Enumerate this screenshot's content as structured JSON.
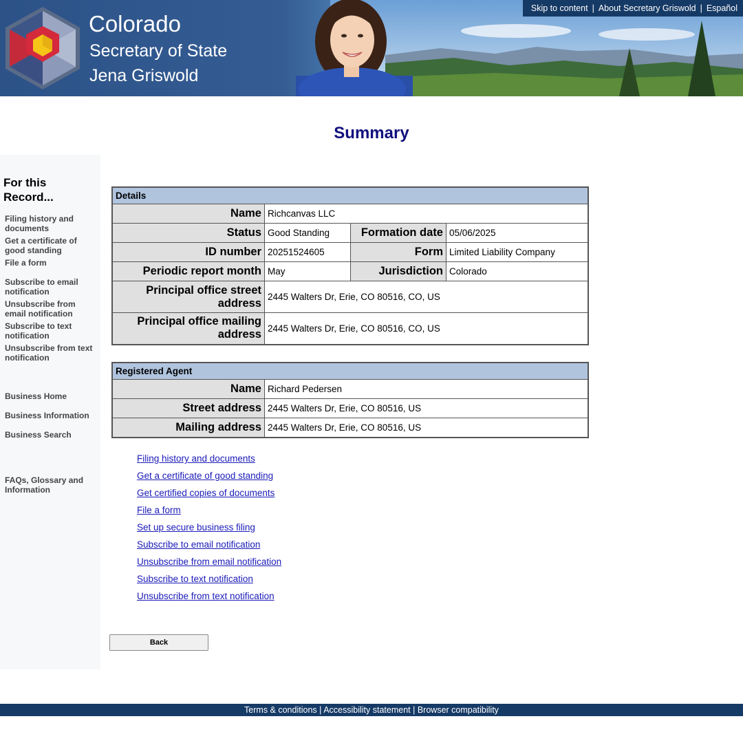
{
  "header": {
    "title_line1": "Colorado",
    "title_line2": "Secretary of State",
    "title_line3": "Jena Griswold",
    "top_links": [
      "Skip to content",
      "About Secretary Griswold",
      "Español"
    ]
  },
  "page_title": "Summary",
  "sidebar": {
    "heading": "For this Record...",
    "items": [
      "Filing history and documents",
      "Get a certificate of good standing",
      "File a form",
      "Subscribe to email notification",
      "Unsubscribe from email notification",
      "Subscribe to text notification",
      "Unsubscribe from text notification",
      "Business Home",
      "Business Information",
      "Business Search",
      "FAQs, Glossary and Information"
    ]
  },
  "details": {
    "header": "Details",
    "name_label": "Name",
    "name_value": "Richcanvas LLC",
    "status_label": "Status",
    "status_value": "Good Standing",
    "formation_label": "Formation date",
    "formation_value": "05/06/2025",
    "id_label": "ID number",
    "id_value": "20251524605",
    "form_label": "Form",
    "form_value": "Limited Liability Company",
    "report_label": "Periodic report month",
    "report_value": "May",
    "jurisdiction_label": "Jurisdiction",
    "jurisdiction_value": "Colorado",
    "street_label": "Principal office street address",
    "street_value": "2445 Walters Dr, Erie, CO 80516, CO, US",
    "mailing_label": "Principal office mailing address",
    "mailing_value": "2445 Walters Dr, Erie, CO 80516, CO, US"
  },
  "agent": {
    "header": "Registered Agent",
    "name_label": "Name",
    "name_value": "Richard Pedersen",
    "street_label": "Street address",
    "street_value": "2445 Walters Dr, Erie, CO 80516, US",
    "mailing_label": "Mailing address",
    "mailing_value": "2445 Walters Dr, Erie, CO 80516, US"
  },
  "links": [
    "Filing history and documents",
    "Get a certificate of good standing",
    "Get certified copies of documents",
    "File a form",
    "Set up secure business filing",
    "Subscribe to email notification",
    "Unsubscribe from email notification",
    "Subscribe to text notification",
    "Unsubscribe from text notification"
  ],
  "back_label": "Back",
  "footer": {
    "links": [
      "Terms & conditions",
      "Accessibility statement",
      "Browser compatibility"
    ],
    "separator": "|"
  },
  "colors": {
    "title": "#10107e",
    "header_bar": "#163a66",
    "table_header": "#b0c4de",
    "label_cell": "#e0e0e0",
    "link": "#1a1ab8"
  }
}
